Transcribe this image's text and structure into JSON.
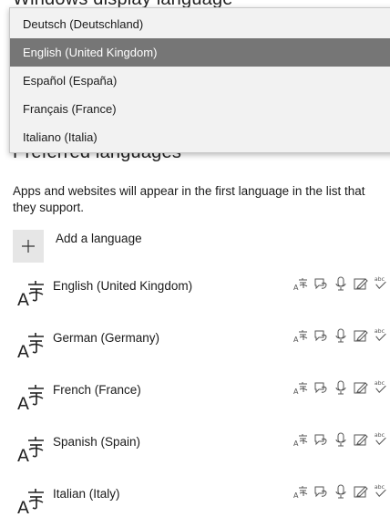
{
  "headings": {
    "display_language": "Windows display language",
    "preferred_languages": "Preferred languages"
  },
  "dropdown": {
    "options": [
      "Deutsch (Deutschland)",
      "English (United Kingdom)",
      "Español (España)",
      "Français (France)",
      "Italiano (Italia)"
    ],
    "selected": "English (United Kingdom)"
  },
  "description": "Apps and websites will appear in the first language in the list that they support.",
  "add_language": {
    "label": "Add a language",
    "icon": "plus-icon"
  },
  "languages": [
    "English (United Kingdom)",
    "German (Germany)",
    "French (France)",
    "Spanish (Spain)",
    "Italian (Italy)"
  ],
  "feature_icons": [
    "display-language-icon",
    "text-to-speech-icon",
    "speech-recognition-icon",
    "handwriting-icon",
    "spell-check-icon"
  ],
  "colors": {
    "selected_bg": "#767676",
    "dropdown_bg": "#f2f2f2",
    "add_button_bg": "#e6e6e6"
  }
}
